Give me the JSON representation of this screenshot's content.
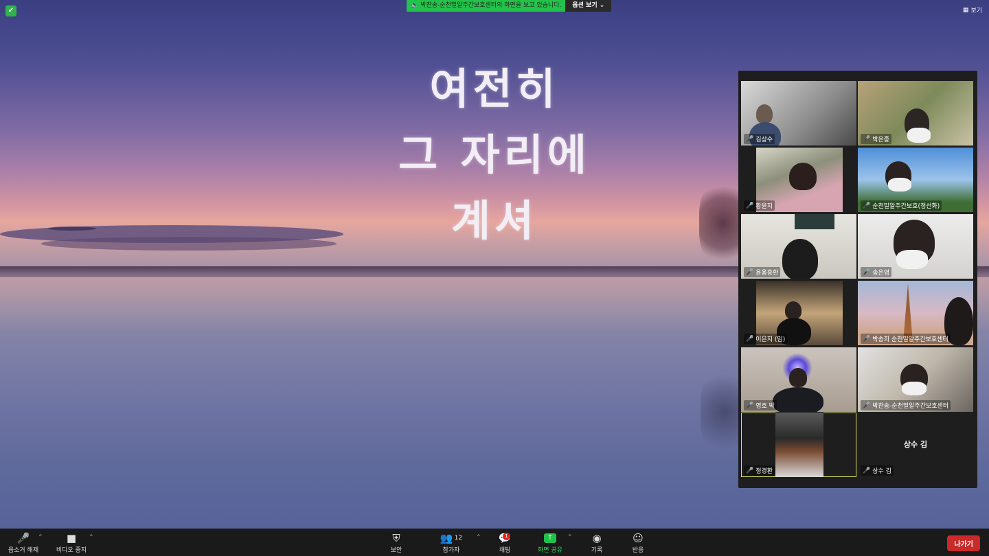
{
  "lyrics": [
    "여전히",
    "그 자리에",
    "계셔"
  ],
  "banner": {
    "message": "박찬송-순천밀알주간보호센터의 화면을 보고 있습니다.",
    "options_label": "옵션 보기"
  },
  "view_label": "보기",
  "participants": [
    {
      "name": "김상수",
      "muted": true
    },
    {
      "name": "박은종",
      "muted": true
    },
    {
      "name": "황윤지",
      "muted": true
    },
    {
      "name": "순천밀알주간보호(정선화)",
      "muted": true
    },
    {
      "name": "윤용흥환",
      "muted": true
    },
    {
      "name": "송은영",
      "muted": true
    },
    {
      "name": "이은지 (밈)",
      "muted": true
    },
    {
      "name": "박송희 순천밀알주간보호센터",
      "muted": true
    },
    {
      "name": "영호 박",
      "muted": true
    },
    {
      "name": "박찬송-순천밀알주간보호센터",
      "muted": true
    },
    {
      "name": "정경환",
      "muted": true,
      "active": true
    },
    {
      "name": "상수 김",
      "muted": true,
      "display_name": "상수 김"
    }
  ],
  "toolbar": {
    "unmute": "음소거 해제",
    "stop_video": "비디오 중지",
    "security": "보안",
    "participants": "참가자",
    "participants_count": "12",
    "chat": "채팅",
    "chat_badge": "1",
    "share_screen": "화면 공유",
    "record": "기록",
    "reactions": "반응",
    "leave": "나가기"
  },
  "colors": {
    "share_green": "#23c24a",
    "leave_red": "#c92a2a",
    "active_speaker": "#d8e06a"
  }
}
